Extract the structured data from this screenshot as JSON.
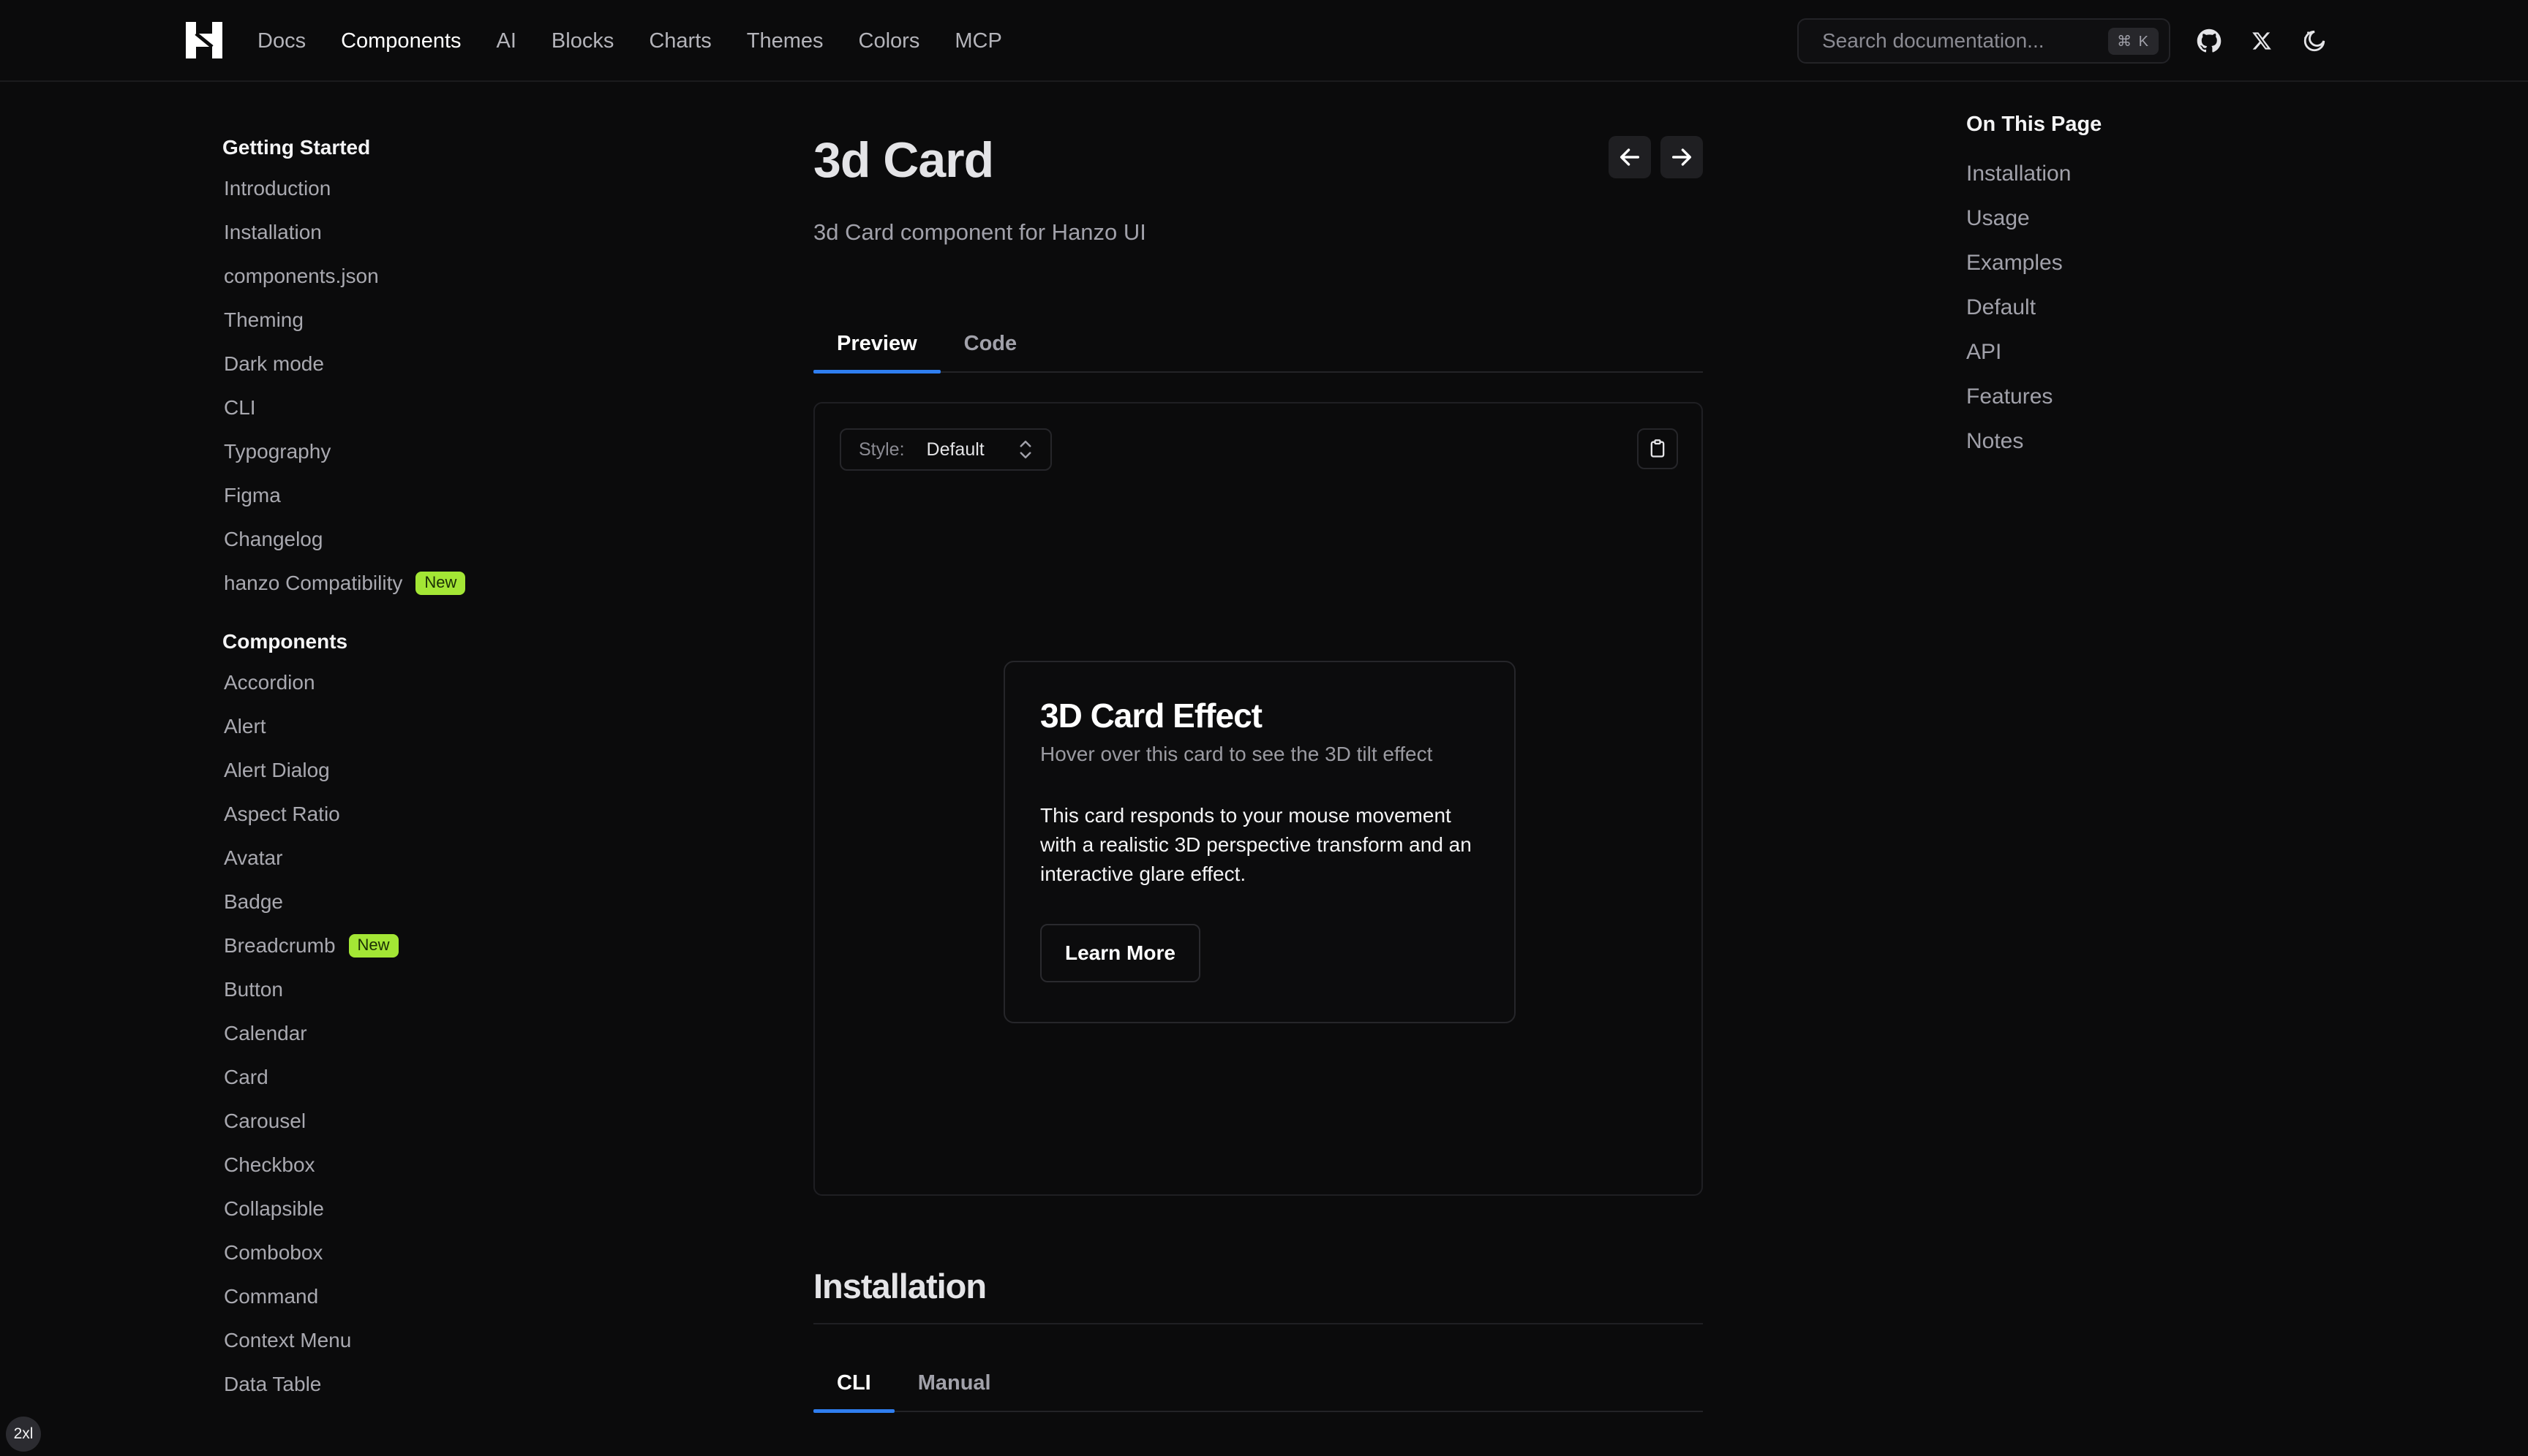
{
  "header": {
    "nav": [
      "Docs",
      "Components",
      "AI",
      "Blocks",
      "Charts",
      "Themes",
      "Colors",
      "MCP"
    ],
    "active_nav": "Components",
    "search_placeholder": "Search documentation...",
    "search_shortcut": "⌘ K"
  },
  "sidebar": {
    "getting_started": {
      "heading": "Getting Started",
      "items": [
        {
          "label": "Introduction"
        },
        {
          "label": "Installation"
        },
        {
          "label": "components.json"
        },
        {
          "label": "Theming"
        },
        {
          "label": "Dark mode"
        },
        {
          "label": "CLI"
        },
        {
          "label": "Typography"
        },
        {
          "label": "Figma"
        },
        {
          "label": "Changelog"
        },
        {
          "label": "hanzo Compatibility",
          "badge": "New"
        }
      ]
    },
    "components": {
      "heading": "Components",
      "items": [
        {
          "label": "Accordion"
        },
        {
          "label": "Alert"
        },
        {
          "label": "Alert Dialog"
        },
        {
          "label": "Aspect Ratio"
        },
        {
          "label": "Avatar"
        },
        {
          "label": "Badge"
        },
        {
          "label": "Breadcrumb",
          "badge": "New"
        },
        {
          "label": "Button"
        },
        {
          "label": "Calendar"
        },
        {
          "label": "Card"
        },
        {
          "label": "Carousel"
        },
        {
          "label": "Checkbox"
        },
        {
          "label": "Collapsible"
        },
        {
          "label": "Combobox"
        },
        {
          "label": "Command"
        },
        {
          "label": "Context Menu"
        },
        {
          "label": "Data Table"
        }
      ]
    }
  },
  "main": {
    "title": "3d Card",
    "subtitle": "3d Card component for Hanzo UI",
    "tabs": [
      "Preview",
      "Code"
    ],
    "preview": {
      "style_label": "Style:",
      "style_value": "Default",
      "card": {
        "title": "3D Card Effect",
        "description": "Hover over this card to see the 3D tilt effect",
        "body": "This card responds to your mouse movement with a realistic 3D perspective transform and an interactive glare effect.",
        "button": "Learn More"
      }
    },
    "installation": {
      "title": "Installation",
      "tabs": [
        "CLI",
        "Manual"
      ]
    }
  },
  "toc": {
    "heading": "On This Page",
    "items": [
      "Installation",
      "Usage",
      "Examples",
      "Default",
      "API",
      "Features",
      "Notes"
    ]
  },
  "breakpoint_indicator": "2xl",
  "colors": {
    "background": "#0b0b0c",
    "accent_tab": "#2f7ef0",
    "badge": "#a3e635"
  }
}
